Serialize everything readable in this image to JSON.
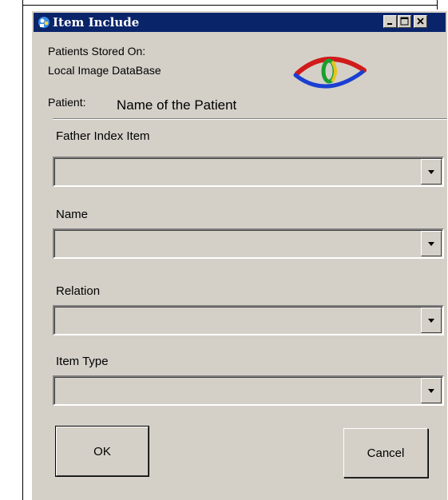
{
  "window": {
    "title": "Item Include",
    "controls": {
      "minimize": "minimize",
      "maximize": "maximize",
      "close": "close"
    }
  },
  "header": {
    "stored_on_label": "Patients Stored On:",
    "stored_on_value": "Local Image DataBase",
    "patient_label": "Patient:",
    "patient_name": "Name of the Patient"
  },
  "fields": {
    "father_index_item": {
      "label": "Father Index Item",
      "value": ""
    },
    "name": {
      "label": "Name",
      "value": ""
    },
    "relation": {
      "label": "Relation",
      "value": ""
    },
    "item_type": {
      "label": "Item Type",
      "value": ""
    }
  },
  "buttons": {
    "ok": "OK",
    "cancel": "Cancel"
  },
  "icons": {
    "title_icon": "globe-people-icon",
    "logo": "eye-logo",
    "dropdown_arrow": "chevron-down-icon"
  },
  "colors": {
    "titlebar": "#0a246a",
    "dialog_face": "#d4d0c8",
    "logo_red": "#d11a1a",
    "logo_blue": "#1a3fd1",
    "logo_green": "#1a9e2f",
    "logo_yellow": "#e7c61a"
  }
}
